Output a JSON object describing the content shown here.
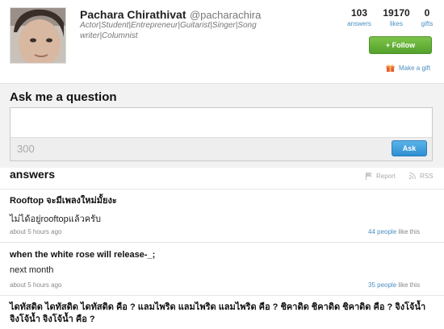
{
  "profile": {
    "name": "Pachara Chirathivat",
    "username": "@pacharachira",
    "bio": "Actor|Student|Entrepreneur|Guitarist|Singer|Song writer|Columnist"
  },
  "stats": {
    "answers_count": "103",
    "answers_label": "answers",
    "likes_count": "19170",
    "likes_label": "likes",
    "gifts_count": "0",
    "gifts_label": "gifts"
  },
  "actions": {
    "follow_label": "+ Follow",
    "gift_label": "Make a gift"
  },
  "ask": {
    "title": "Ask me a question",
    "char_count": "300",
    "button_label": "Ask"
  },
  "answers_section": {
    "title": "answers",
    "report_label": "Report",
    "rss_label": "RSS"
  },
  "answers": [
    {
      "question": "Rooftop จะมีเพลงใหม่มั้ยงะ",
      "answer": "ไม่ได้อยู่rooftopแล้วครับ",
      "time": "about 5 hours ago",
      "likes_people": "44 people",
      "likes_suffix": "like this"
    },
    {
      "question": "when the white rose will release-_;",
      "answer": "next month",
      "time": "about 5 hours ago",
      "likes_people": "35 people",
      "likes_suffix": "like this"
    },
    {
      "question": "ไดทัสดิด ไดทัสดิด ไดทัสดิด คือ ? แลมไพริด แลมไพริด แลมไพริด คือ ? ชิคาดิด ชิคาดิด ชิคาดิด คือ ? จิงโจ้น้ำ จิงโจ้น้ำ จิงโจ้น้ำ คือ ?"
    }
  ],
  "colors": {
    "link_blue": "#4a8fc2",
    "follow_green": "#5fae33",
    "ask_blue": "#3a9ad9"
  }
}
